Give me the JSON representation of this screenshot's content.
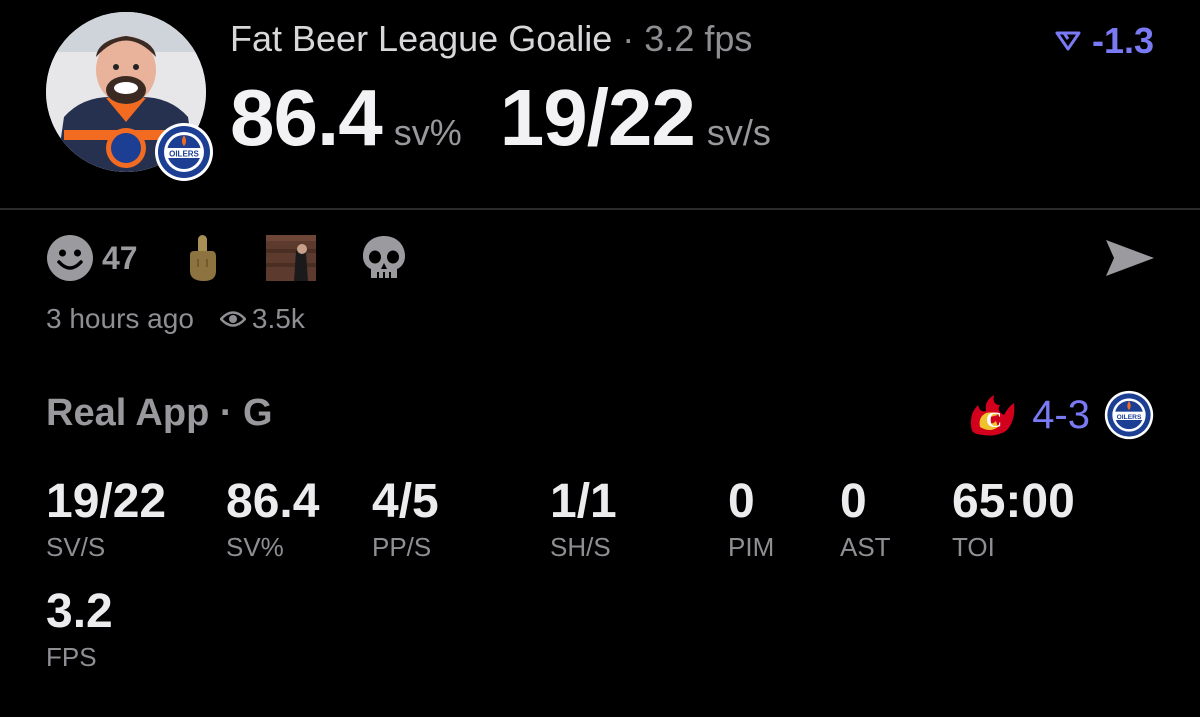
{
  "header": {
    "name": "Fat Beer League Goalie",
    "separator": "·",
    "fps": "3.2 fps",
    "save_pct": "86.4",
    "save_pct_unit": "sv%",
    "saves_shots": "19/22",
    "saves_shots_unit": "sv/s",
    "delta": "-1.3"
  },
  "reactions": {
    "smile_count": "47",
    "smile_icon": "smiley-face-icon",
    "finger_icon": "middle-finger-emoji",
    "gif_icon": "reaction-gif-thumbnail",
    "skull_icon": "skull-emoji"
  },
  "meta": {
    "time_ago": "3 hours ago",
    "views": "3.5k"
  },
  "game": {
    "title": "Real App · G",
    "score": "4-3",
    "away_team_icon": "calgary-flames-logo",
    "home_team_icon": "edmonton-oilers-logo"
  },
  "stats": [
    {
      "value": "19/22",
      "label": "SV/S"
    },
    {
      "value": "86.4",
      "label": "SV%"
    },
    {
      "value": "4/5",
      "label": "PP/S"
    },
    {
      "value": "1/1",
      "label": "SH/S"
    },
    {
      "value": "0",
      "label": "PIM"
    },
    {
      "value": "0",
      "label": "AST"
    },
    {
      "value": "65:00",
      "label": "TOI"
    },
    {
      "value": "3.2",
      "label": "FPS"
    }
  ],
  "colors": {
    "accent": "#7a7af5",
    "oilers_blue": "#1c3f94",
    "oilers_orange": "#f26b21",
    "flames_red": "#d2001c"
  }
}
